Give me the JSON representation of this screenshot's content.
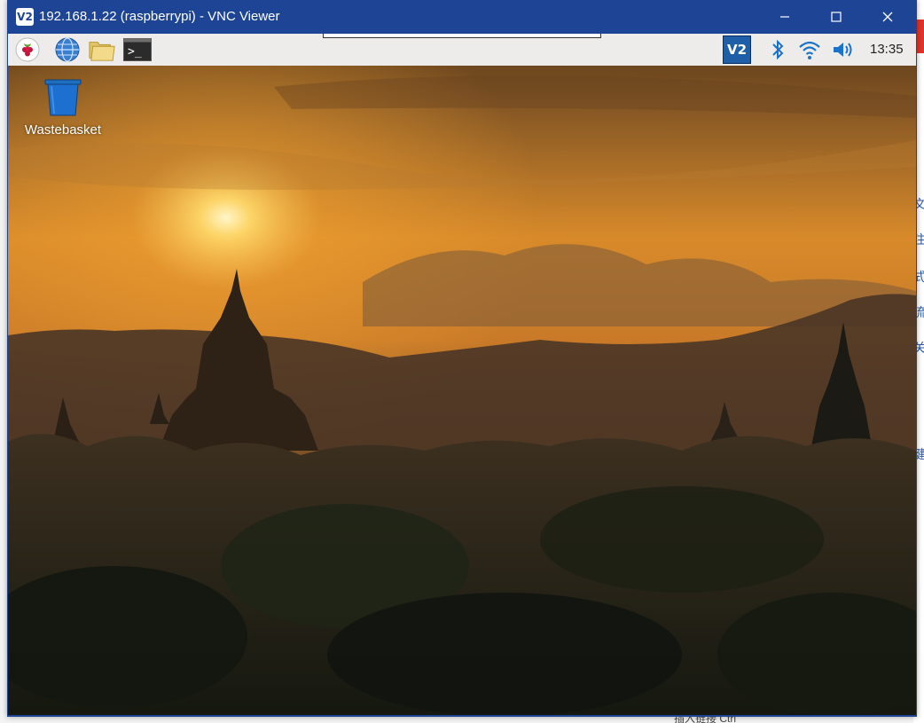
{
  "window": {
    "logo": "V2",
    "title": "192.168.1.22 (raspberrypi) - VNC Viewer",
    "controls": [
      "minimize-icon",
      "maximize-icon",
      "close-icon"
    ]
  },
  "taskbar": {
    "launchers": [
      "raspberry-menu-icon",
      "web-browser-icon",
      "file-manager-icon",
      "terminal-icon"
    ],
    "terminal_glyph": ">_",
    "tray": [
      "vnc-server-icon",
      "bluetooth-icon",
      "wifi-icon",
      "volume-icon"
    ],
    "vnc_tray_label": "V2",
    "clock": "13:35"
  },
  "desktop": {
    "icons": [
      {
        "label": "Wastebasket",
        "icon": "wastebasket-icon"
      }
    ],
    "wallpaper": "sunset-temples"
  },
  "background_app": {
    "side_glyphs": [
      "文",
      "注",
      "式",
      "流",
      "关",
      "健"
    ],
    "bottom_text": "插入链接        Ctrl",
    "accent": "#e0342c"
  },
  "colors": {
    "titlebar": "#1e4496",
    "taskbar": "#edeceb",
    "vnc_tray": "#1f5fa8"
  }
}
